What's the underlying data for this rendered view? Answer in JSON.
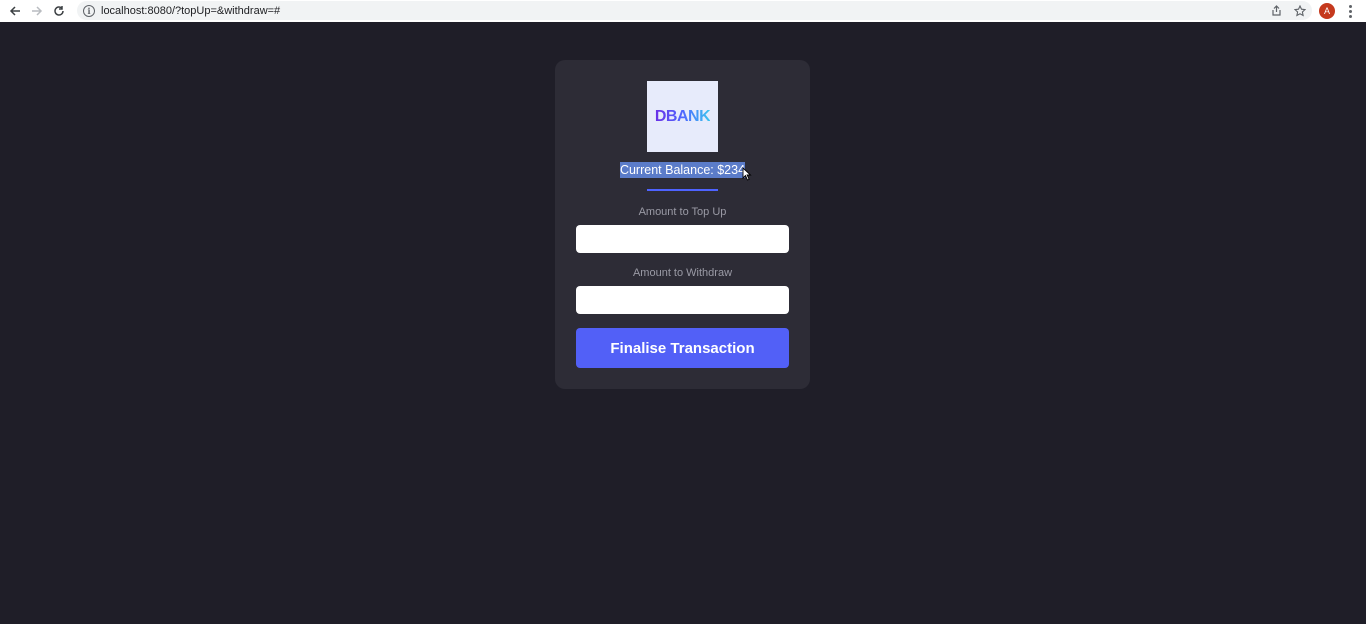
{
  "browser": {
    "url": "localhost:8080/?topUp=&withdraw=#",
    "avatar_letter": "A",
    "icons": {
      "back": "arrow-left-icon",
      "forward": "arrow-right-icon",
      "reload": "reload-icon",
      "info": "info-icon",
      "share": "share-icon",
      "bookmark": "star-icon",
      "menu": "more-vertical-icon"
    }
  },
  "app": {
    "logo_text": "DBANK",
    "balance_text": "Current Balance: $234",
    "topup_label": "Amount to Top Up",
    "topup_value": "",
    "withdraw_label": "Amount to Withdraw",
    "withdraw_value": "",
    "submit_label": "Finalise Transaction"
  },
  "colors": {
    "page_background": "#1f1e28",
    "card_background": "#2d2c36",
    "accent": "#5260f7",
    "selection": "#5b7cc9"
  }
}
